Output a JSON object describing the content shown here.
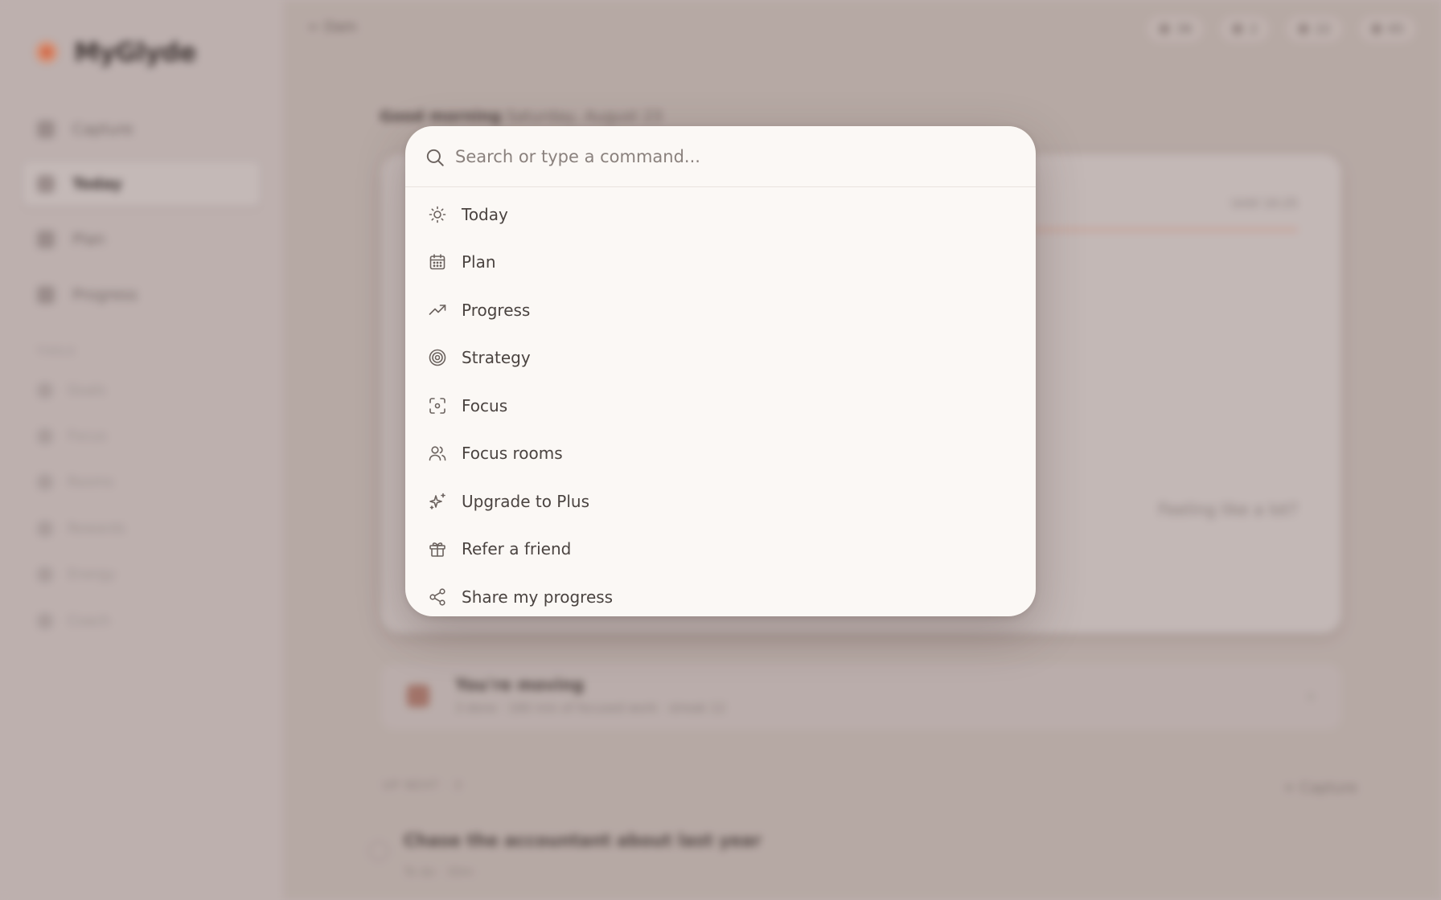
{
  "app": {
    "brand": "MyGlyde",
    "back_label": "← Dam",
    "nav": [
      {
        "label": "Capture",
        "icon": "plus-icon"
      },
      {
        "label": "Today",
        "icon": "sun-icon"
      },
      {
        "label": "Plan",
        "icon": "calendar-icon"
      },
      {
        "label": "Progress",
        "icon": "trend-icon"
      }
    ],
    "tools_label": "TOOLS",
    "tools": [
      "Goals",
      "Focus",
      "Rooms",
      "Rewards",
      "Energy",
      "Coach"
    ],
    "top_pills": [
      "36",
      "2",
      "22",
      "65"
    ],
    "greeting_bold": "Good morning",
    "greeting_rest": "Saturday, August 23",
    "until_text": "Until 10:25",
    "feeling_text": "Feeling like a lot?",
    "moving_title": "You're moving",
    "moving_sub": "3 done · 160 min of focused work · streak 12",
    "up_next_label": "UP NEXT · 3",
    "capture_label": "+ Capture",
    "task_title": "Chase the accountant about last year",
    "task_meta": "To do · 30m"
  },
  "palette": {
    "search_placeholder": "Search or type a command...",
    "commands": [
      {
        "label": "Today",
        "icon": "sun-icon"
      },
      {
        "label": "Plan",
        "icon": "calendar-icon"
      },
      {
        "label": "Progress",
        "icon": "trending-up-icon"
      },
      {
        "label": "Strategy",
        "icon": "target-icon"
      },
      {
        "label": "Focus",
        "icon": "focus-scan-icon"
      },
      {
        "label": "Focus rooms",
        "icon": "users-icon"
      },
      {
        "label": "Upgrade to Plus",
        "icon": "sparkles-icon"
      },
      {
        "label": "Refer a friend",
        "icon": "gift-icon"
      },
      {
        "label": "Share my progress",
        "icon": "share-icon"
      }
    ]
  }
}
